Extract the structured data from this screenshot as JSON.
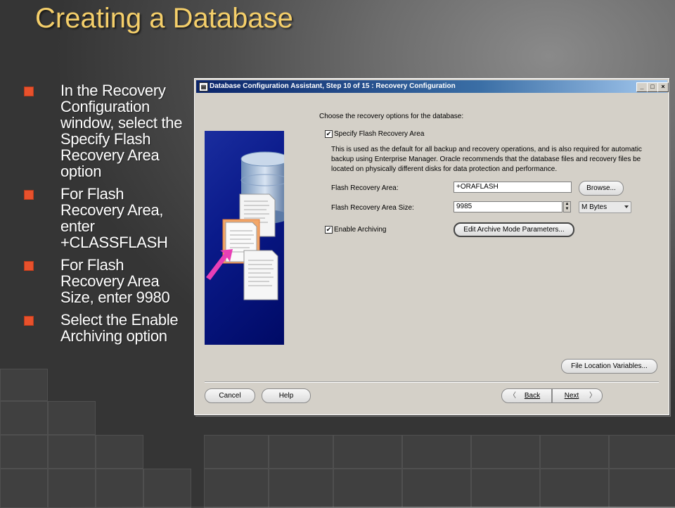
{
  "slide": {
    "title": "Creating a Database",
    "bullets": [
      "In the Recovery Configuration window, select the Specify Flash Recovery Area option",
      "For Flash Recovery Area, enter +CLASSFLASH",
      "For Flash Recovery Area Size, enter 9980",
      "Select the Enable Archiving option"
    ]
  },
  "window": {
    "title": "Database Configuration Assistant, Step 10 of 15 : Recovery Configuration",
    "controls": {
      "minimize": "_",
      "maximize": "□",
      "close": "×"
    }
  },
  "form": {
    "prompt": "Choose the recovery options for the database:",
    "specify_flash_label": "Specify Flash Recovery Area",
    "specify_flash_checked": true,
    "description": "This is used as the default for all backup and recovery operations, and is also required for automatic backup using Enterprise Manager. Oracle recommends that the database files and recovery files be located on physically different disks for data protection and performance.",
    "flash_area_label": "Flash Recovery Area:",
    "flash_area_value": "+ORAFLASH",
    "browse_label": "Browse...",
    "flash_size_label": "Flash Recovery Area Size:",
    "flash_size_value": "9985",
    "size_unit": "M Bytes",
    "enable_archiving_label": "Enable Archiving",
    "enable_archiving_checked": true,
    "archive_params_label": "Edit Archive Mode Parameters...",
    "file_location_label": "File Location Variables..."
  },
  "footer": {
    "cancel_label": "Cancel",
    "help_label": "Help",
    "back_label": "Back",
    "next_label": "Next"
  },
  "colors": {
    "title_gold": "#f5cf6a",
    "bullet_orange": "#e8512c",
    "titlebar_blue": "#0a246a",
    "dialog_gray": "#d4d0c8"
  }
}
